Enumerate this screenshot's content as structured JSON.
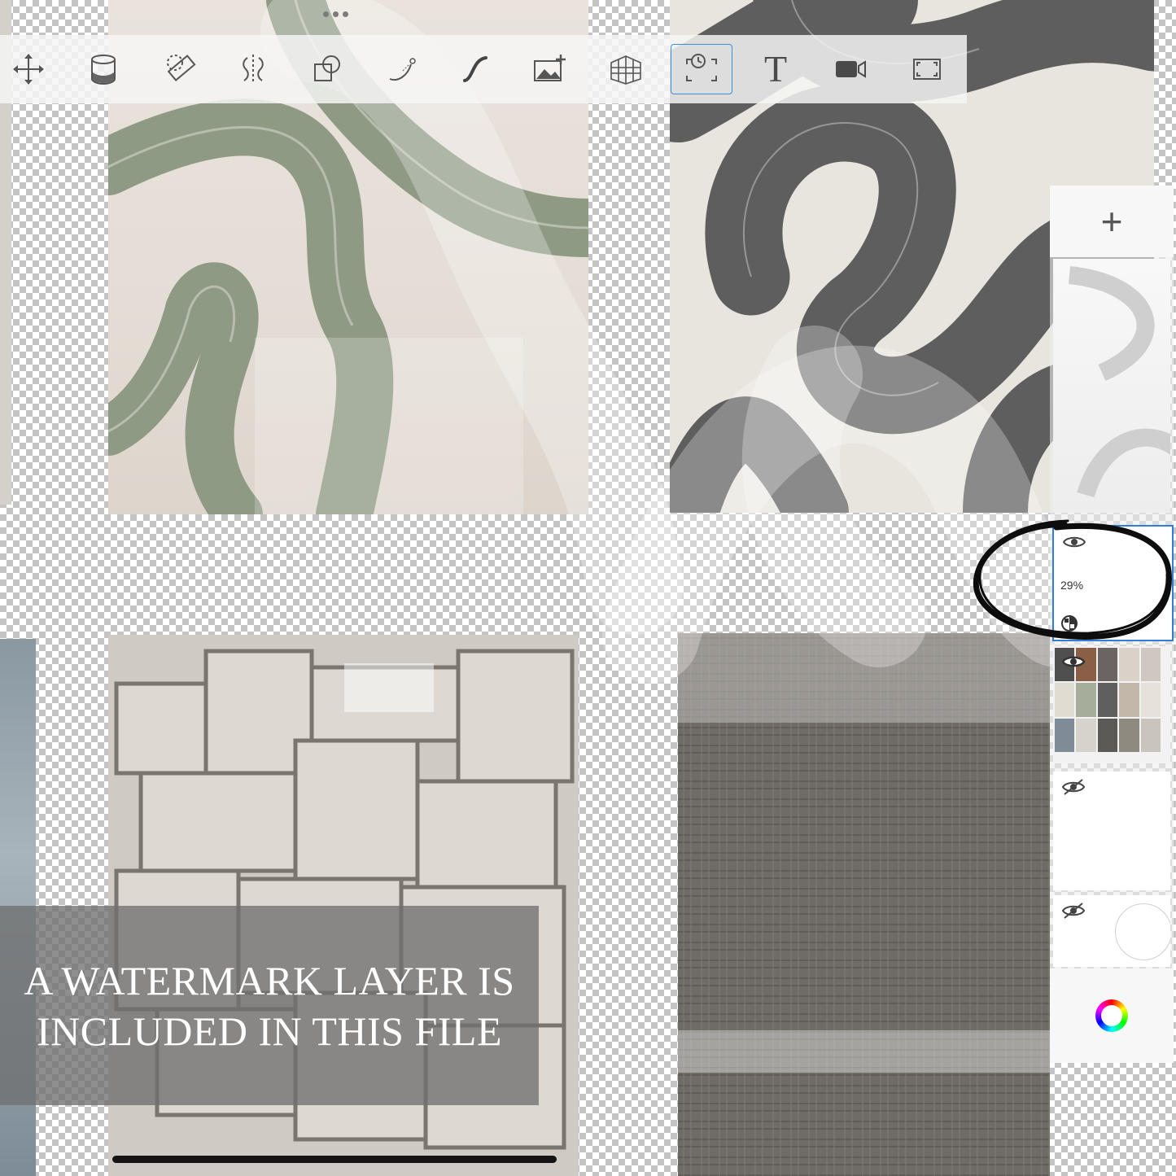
{
  "toolbar": {
    "tools": [
      {
        "name": "transform",
        "icon": "move-arrows-icon"
      },
      {
        "name": "fill",
        "icon": "paint-bucket-icon"
      },
      {
        "name": "ruler",
        "icon": "ruler-icon"
      },
      {
        "name": "symmetry",
        "icon": "symmetry-icon"
      },
      {
        "name": "shapes",
        "icon": "shapes-icon"
      },
      {
        "name": "curve",
        "icon": "curve-pen-icon"
      },
      {
        "name": "stroke",
        "icon": "stroke-icon"
      },
      {
        "name": "import-image",
        "icon": "image-add-icon"
      },
      {
        "name": "perspective",
        "icon": "perspective-grid-icon"
      },
      {
        "name": "time-lapse",
        "icon": "timelapse-icon",
        "active": true
      },
      {
        "name": "text",
        "icon": "text-icon",
        "glyph": "T"
      },
      {
        "name": "record",
        "icon": "video-camera-icon"
      },
      {
        "name": "fullscreen",
        "icon": "fullscreen-icon"
      }
    ],
    "accent": "#3b8fe0"
  },
  "layers": {
    "add_label": "+",
    "selected": {
      "opacity": "29%",
      "visible": true
    },
    "layer_3_visible": true,
    "layer_4_visible": false,
    "layer_5_visible": false,
    "selection_color": "#2f7fd8"
  },
  "watermark": {
    "line1": "A WATERMARK LAYER IS",
    "line2": "INCLUDED IN THIS FILE"
  },
  "colors": {
    "sage": "#8f9a85",
    "charcoal": "#5b5b5b",
    "linen": "#6d6a64"
  }
}
